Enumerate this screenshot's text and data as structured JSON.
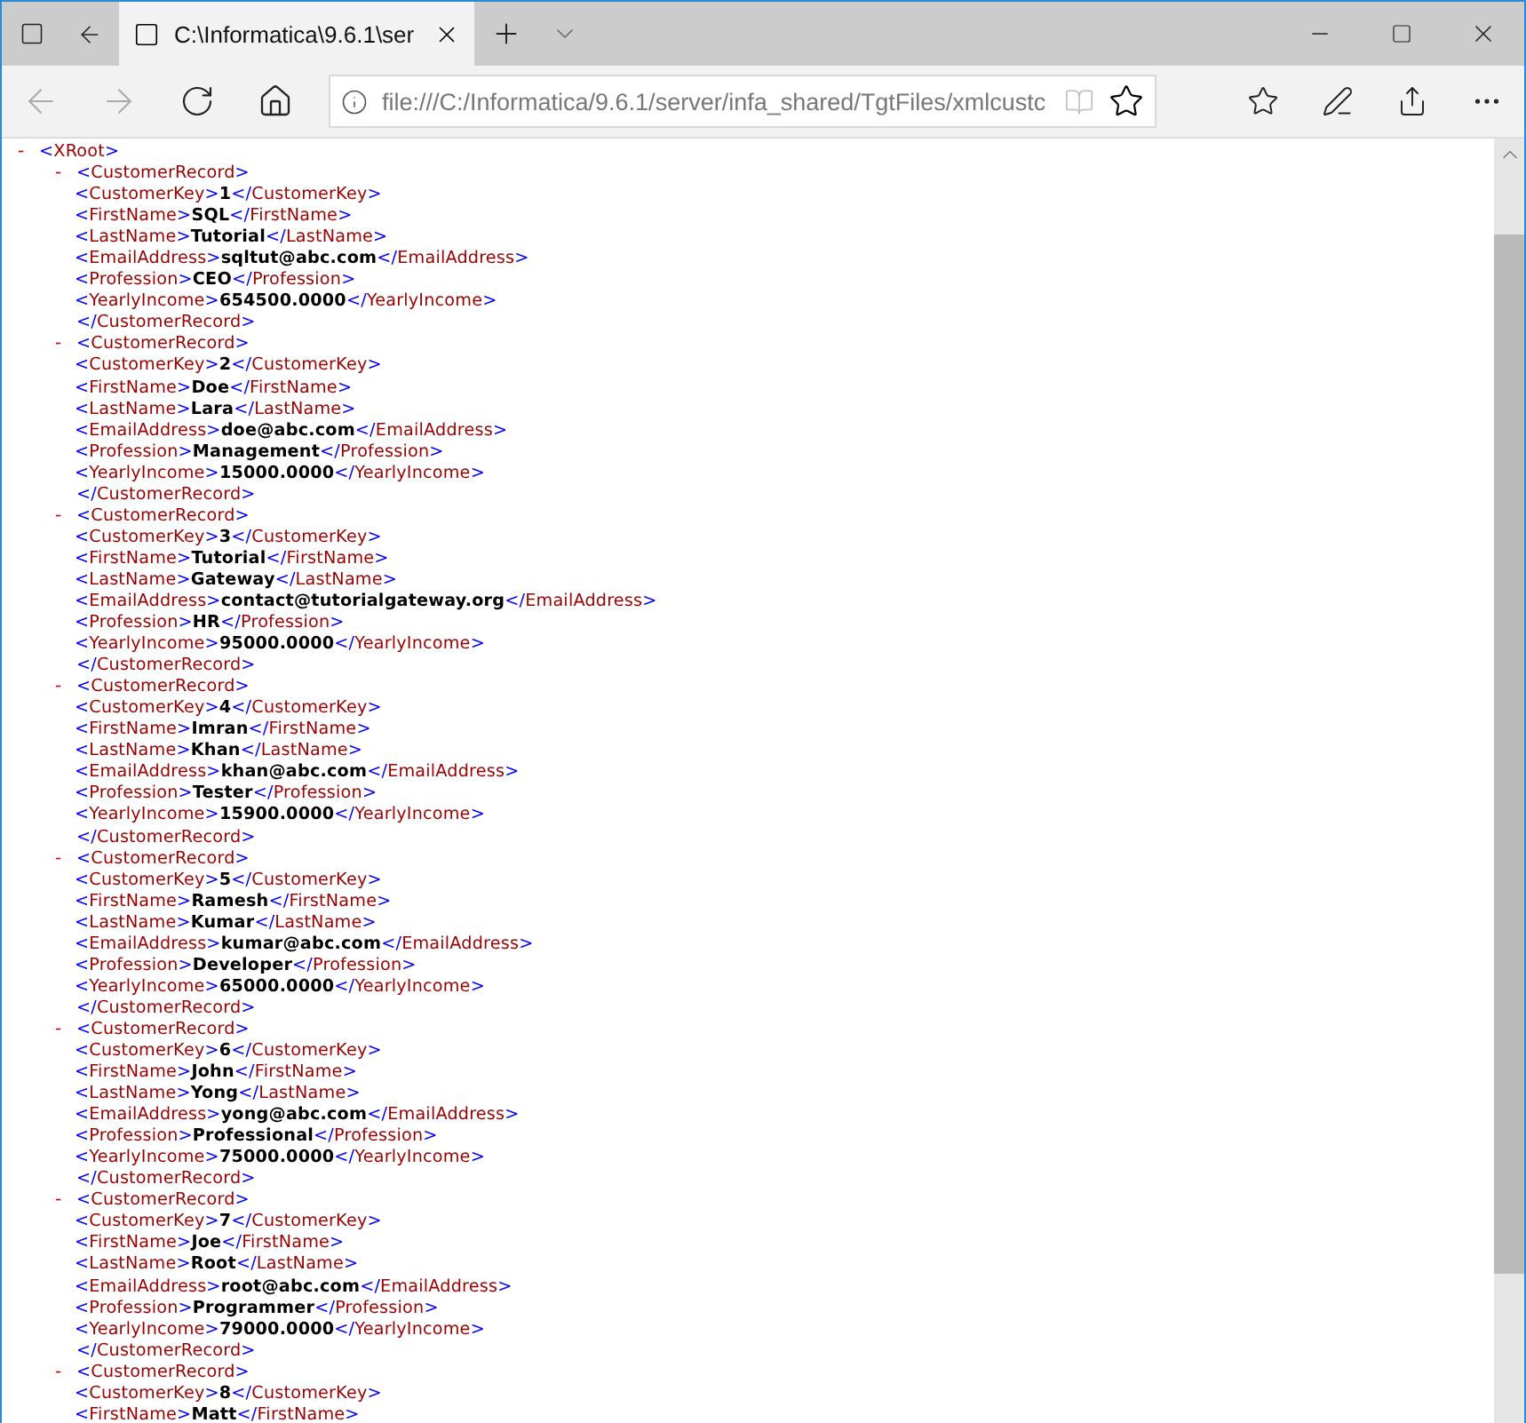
{
  "browser": {
    "tab_title": "C:\\Informatica\\9.6.1\\ser",
    "address": "file:///C:/Informatica/9.6.1/server/infa_shared/TgtFiles/xmlcustc"
  },
  "document": {
    "toggle": "-",
    "open": "<XRoot>",
    "children": [
      {
        "toggle": "-",
        "open": "<CustomerRecord>",
        "close": "</CustomerRecord>",
        "children": [
          {
            "open": "<CustomerKey>",
            "value": "1",
            "close": "</CustomerKey>"
          },
          {
            "open": "<FirstName>",
            "value": "SQL",
            "close": "</FirstName>"
          },
          {
            "open": "<LastName>",
            "value": "Tutorial",
            "close": "</LastName>"
          },
          {
            "open": "<EmailAddress>",
            "value": "sqltut@abc.com",
            "close": "</EmailAddress>"
          },
          {
            "open": "<Profession>",
            "value": "CEO",
            "close": "</Profession>"
          },
          {
            "open": "<YearlyIncome>",
            "value": "654500.0000",
            "close": "</YearlyIncome>"
          }
        ]
      },
      {
        "toggle": "-",
        "open": "<CustomerRecord>",
        "close": "</CustomerRecord>",
        "children": [
          {
            "open": "<CustomerKey>",
            "value": "2",
            "close": "</CustomerKey>"
          },
          {
            "open": "<FirstName>",
            "value": "Doe",
            "close": "</FirstName>"
          },
          {
            "open": "<LastName>",
            "value": "Lara",
            "close": "</LastName>"
          },
          {
            "open": "<EmailAddress>",
            "value": "doe@abc.com",
            "close": "</EmailAddress>"
          },
          {
            "open": "<Profession>",
            "value": "Management",
            "close": "</Profession>"
          },
          {
            "open": "<YearlyIncome>",
            "value": "15000.0000",
            "close": "</YearlyIncome>"
          }
        ]
      },
      {
        "toggle": "-",
        "open": "<CustomerRecord>",
        "close": "</CustomerRecord>",
        "children": [
          {
            "open": "<CustomerKey>",
            "value": "3",
            "close": "</CustomerKey>"
          },
          {
            "open": "<FirstName>",
            "value": "Tutorial",
            "close": "</FirstName>"
          },
          {
            "open": "<LastName>",
            "value": "Gateway",
            "close": "</LastName>"
          },
          {
            "open": "<EmailAddress>",
            "value": "contact@tutorialgateway.org",
            "close": "</EmailAddress>"
          },
          {
            "open": "<Profession>",
            "value": "HR",
            "close": "</Profession>"
          },
          {
            "open": "<YearlyIncome>",
            "value": "95000.0000",
            "close": "</YearlyIncome>"
          }
        ]
      },
      {
        "toggle": "-",
        "open": "<CustomerRecord>",
        "close": "</CustomerRecord>",
        "children": [
          {
            "open": "<CustomerKey>",
            "value": "4",
            "close": "</CustomerKey>"
          },
          {
            "open": "<FirstName>",
            "value": "Imran",
            "close": "</FirstName>"
          },
          {
            "open": "<LastName>",
            "value": "Khan",
            "close": "</LastName>"
          },
          {
            "open": "<EmailAddress>",
            "value": "khan@abc.com",
            "close": "</EmailAddress>"
          },
          {
            "open": "<Profession>",
            "value": "Tester",
            "close": "</Profession>"
          },
          {
            "open": "<YearlyIncome>",
            "value": "15900.0000",
            "close": "</YearlyIncome>"
          }
        ]
      },
      {
        "toggle": "-",
        "open": "<CustomerRecord>",
        "close": "</CustomerRecord>",
        "children": [
          {
            "open": "<CustomerKey>",
            "value": "5",
            "close": "</CustomerKey>"
          },
          {
            "open": "<FirstName>",
            "value": "Ramesh",
            "close": "</FirstName>"
          },
          {
            "open": "<LastName>",
            "value": "Kumar",
            "close": "</LastName>"
          },
          {
            "open": "<EmailAddress>",
            "value": "kumar@abc.com",
            "close": "</EmailAddress>"
          },
          {
            "open": "<Profession>",
            "value": "Developer",
            "close": "</Profession>"
          },
          {
            "open": "<YearlyIncome>",
            "value": "65000.0000",
            "close": "</YearlyIncome>"
          }
        ]
      },
      {
        "toggle": "-",
        "open": "<CustomerRecord>",
        "close": "</CustomerRecord>",
        "children": [
          {
            "open": "<CustomerKey>",
            "value": "6",
            "close": "</CustomerKey>"
          },
          {
            "open": "<FirstName>",
            "value": "John",
            "close": "</FirstName>"
          },
          {
            "open": "<LastName>",
            "value": "Yong",
            "close": "</LastName>"
          },
          {
            "open": "<EmailAddress>",
            "value": "yong@abc.com",
            "close": "</EmailAddress>"
          },
          {
            "open": "<Profession>",
            "value": "Professional",
            "close": "</Profession>"
          },
          {
            "open": "<YearlyIncome>",
            "value": "75000.0000",
            "close": "</YearlyIncome>"
          }
        ]
      },
      {
        "toggle": "-",
        "open": "<CustomerRecord>",
        "close": "</CustomerRecord>",
        "children": [
          {
            "open": "<CustomerKey>",
            "value": "7",
            "close": "</CustomerKey>"
          },
          {
            "open": "<FirstName>",
            "value": "Joe",
            "close": "</FirstName>"
          },
          {
            "open": "<LastName>",
            "value": "Root",
            "close": "</LastName>"
          },
          {
            "open": "<EmailAddress>",
            "value": "root@abc.com",
            "close": "</EmailAddress>"
          },
          {
            "open": "<Profession>",
            "value": "Programmer",
            "close": "</Profession>"
          },
          {
            "open": "<YearlyIncome>",
            "value": "79000.0000",
            "close": "</YearlyIncome>"
          }
        ]
      },
      {
        "toggle": "-",
        "open": "<CustomerRecord>",
        "children": [
          {
            "open": "<CustomerKey>",
            "value": "8",
            "close": "</CustomerKey>"
          },
          {
            "open": "<FirstName>",
            "value": "Matt",
            "close": "</FirstName>"
          }
        ]
      }
    ]
  }
}
